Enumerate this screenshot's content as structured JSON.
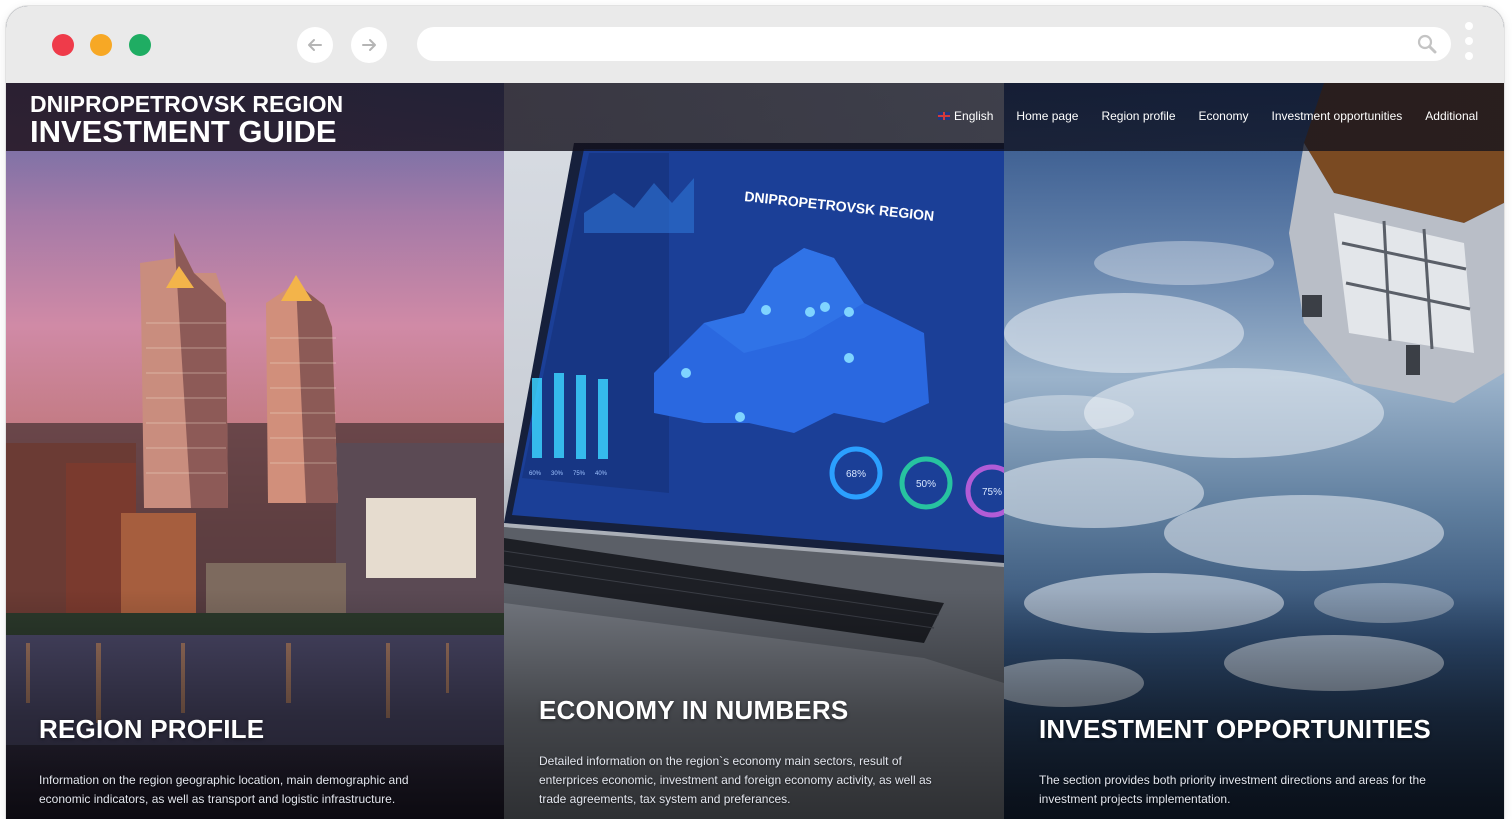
{
  "browser": {
    "url": "",
    "back_icon": "arrow-left-icon",
    "forward_icon": "arrow-right-icon",
    "search_icon": "search-icon",
    "menu_icon": "kebab-menu-icon",
    "traffic_light_colors": [
      "#ef3b4a",
      "#f7a825",
      "#1fad63"
    ]
  },
  "header": {
    "brand_line1": "DNIPROPETROVSK REGION",
    "brand_line2": "INVESTMENT GUIDE",
    "nav": {
      "language": "English",
      "language_icon": "uk-flag-icon",
      "home": "Home page",
      "region_profile": "Region profile",
      "economy": "Economy",
      "investment": "Investment opportunities",
      "additional": "Additional"
    }
  },
  "panels": [
    {
      "title": "REGION PROFILE",
      "description": "Information on the region geographic location, main demographic and economic indicators, as well as transport and logistic infrastructure."
    },
    {
      "title": "ECONOMY IN NUMBERS",
      "description": "Detailed information on the region`s economy main sectors, result of enterprices economic, investment and foreign economy activity, as well as trade agreements, tax system and preferances.",
      "screen": {
        "map_title": "DNIPROPETROVSK REGION",
        "gauges": [
          "68%",
          "50%",
          "75%"
        ],
        "bar_labels": [
          "60%",
          "30%",
          "75%",
          "40%"
        ]
      }
    },
    {
      "title": "INVESTMENT OPPORTUNITIES",
      "description": "The section provides both priority investment directions and areas for the investment projects implementation."
    }
  ]
}
